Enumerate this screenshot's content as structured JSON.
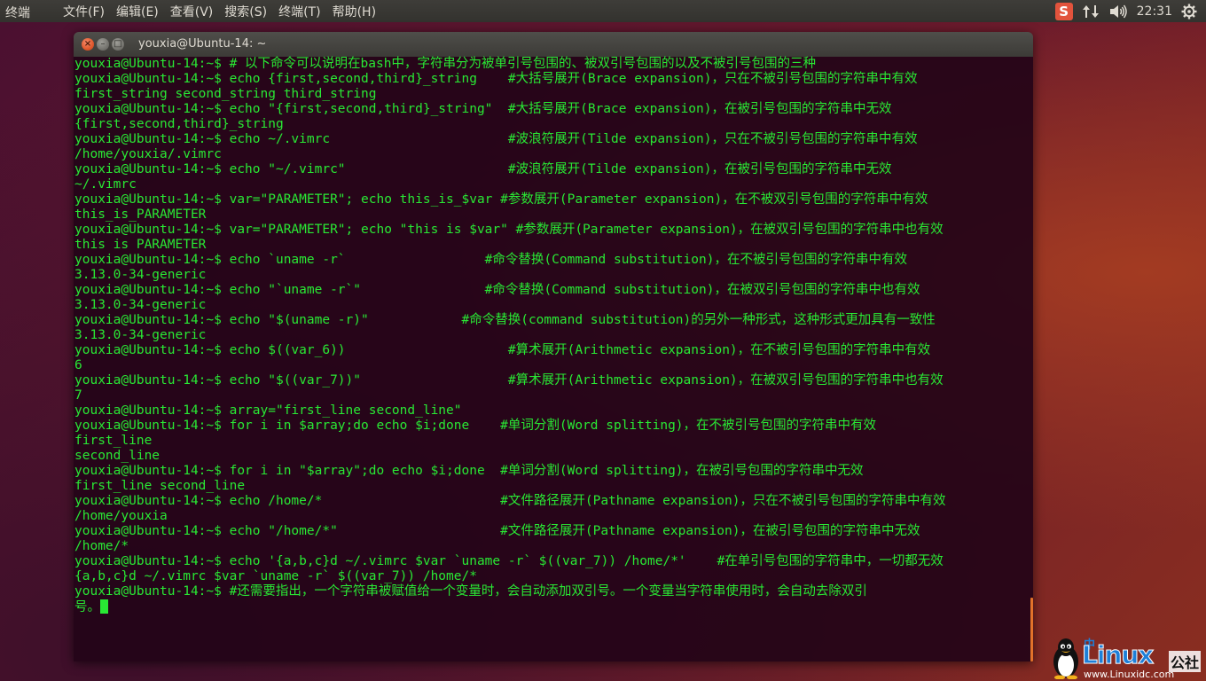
{
  "top_panel": {
    "app_name": "终端",
    "menu": [
      "文件(F)",
      "编辑(E)",
      "查看(V)",
      "搜索(S)",
      "终端(T)",
      "帮助(H)"
    ],
    "tray": {
      "sogou_label": "S",
      "clock": "22:31"
    }
  },
  "window": {
    "title": "youxia@Ubuntu-14: ~",
    "terminal_lines": [
      "youxia@Ubuntu-14:~$ # 以下命令可以说明在bash中，字符串分为被单引号包围的、被双引号包围的以及不被引号包围的三种",
      "youxia@Ubuntu-14:~$ echo {first,second,third}_string    #大括号展开(Brace expansion)，只在不被引号包围的字符串中有效",
      "first_string second_string third_string",
      "youxia@Ubuntu-14:~$ echo \"{first,second,third}_string\"  #大括号展开(Brace expansion)，在被引号包围的字符串中无效",
      "{first,second,third}_string",
      "youxia@Ubuntu-14:~$ echo ~/.vimrc                       #波浪符展开(Tilde expansion)，只在不被引号包围的字符串中有效",
      "/home/youxia/.vimrc",
      "youxia@Ubuntu-14:~$ echo \"~/.vimrc\"                     #波浪符展开(Tilde expansion)，在被引号包围的字符串中无效",
      "~/.vimrc",
      "youxia@Ubuntu-14:~$ var=\"PARAMETER\"; echo this_is_$var #参数展开(Parameter expansion)，在不被双引号包围的字符串中有效",
      "this_is_PARAMETER",
      "youxia@Ubuntu-14:~$ var=\"PARAMETER\"; echo \"this is $var\" #参数展开(Parameter expansion)，在被双引号包围的字符串中也有效",
      "this is PARAMETER",
      "youxia@Ubuntu-14:~$ echo `uname -r`                  #命令替换(Command substitution)，在不被引号包围的字符串中有效",
      "3.13.0-34-generic",
      "youxia@Ubuntu-14:~$ echo \"`uname -r`\"                #命令替换(Command substitution)，在被双引号包围的字符串中也有效",
      "3.13.0-34-generic",
      "youxia@Ubuntu-14:~$ echo \"$(uname -r)\"            #命令替换(command substitution)的另外一种形式，这种形式更加具有一致性",
      "3.13.0-34-generic",
      "youxia@Ubuntu-14:~$ echo $((var_6))                     #算术展开(Arithmetic expansion)，在不被引号包围的字符串中有效",
      "6",
      "youxia@Ubuntu-14:~$ echo \"$((var_7))\"                   #算术展开(Arithmetic expansion)，在被双引号包围的字符串中也有效",
      "7",
      "youxia@Ubuntu-14:~$ array=\"first_line second_line\"",
      "youxia@Ubuntu-14:~$ for i in $array;do echo $i;done    #单词分割(Word splitting)，在不被引号包围的字符串中有效",
      "first_line",
      "second_line",
      "youxia@Ubuntu-14:~$ for i in \"$array\";do echo $i;done  #单词分割(Word splitting)，在被引号包围的字符串中无效",
      "first_line second_line",
      "youxia@Ubuntu-14:~$ echo /home/*                       #文件路径展开(Pathname expansion)，只在不被引号包围的字符串中有效",
      "/home/youxia",
      "youxia@Ubuntu-14:~$ echo \"/home/*\"                     #文件路径展开(Pathname expansion)，在被引号包围的字符串中无效",
      "/home/*",
      "youxia@Ubuntu-14:~$ echo '{a,b,c}d ~/.vimrc $var `uname -r` $((var_7)) /home/*'    #在单引号包围的字符串中，一切都无效",
      "{a,b,c}d ~/.vimrc $var `uname -r` $((var_7)) /home/*",
      "youxia@Ubuntu-14:~$ #还需要指出，一个字符串被赋值给一个变量时，会自动添加双引号。一个变量当字符串使用时，会自动去除双引",
      "号。"
    ]
  },
  "watermark": {
    "brand": "Linux",
    "cn_top": "中",
    "cn_right": "公社",
    "url": "www.Linuxidc.com"
  },
  "colors": {
    "terminal_text": "#29e834",
    "terminal_bg": "#2c0a22",
    "accent_orange": "#e2722a"
  }
}
